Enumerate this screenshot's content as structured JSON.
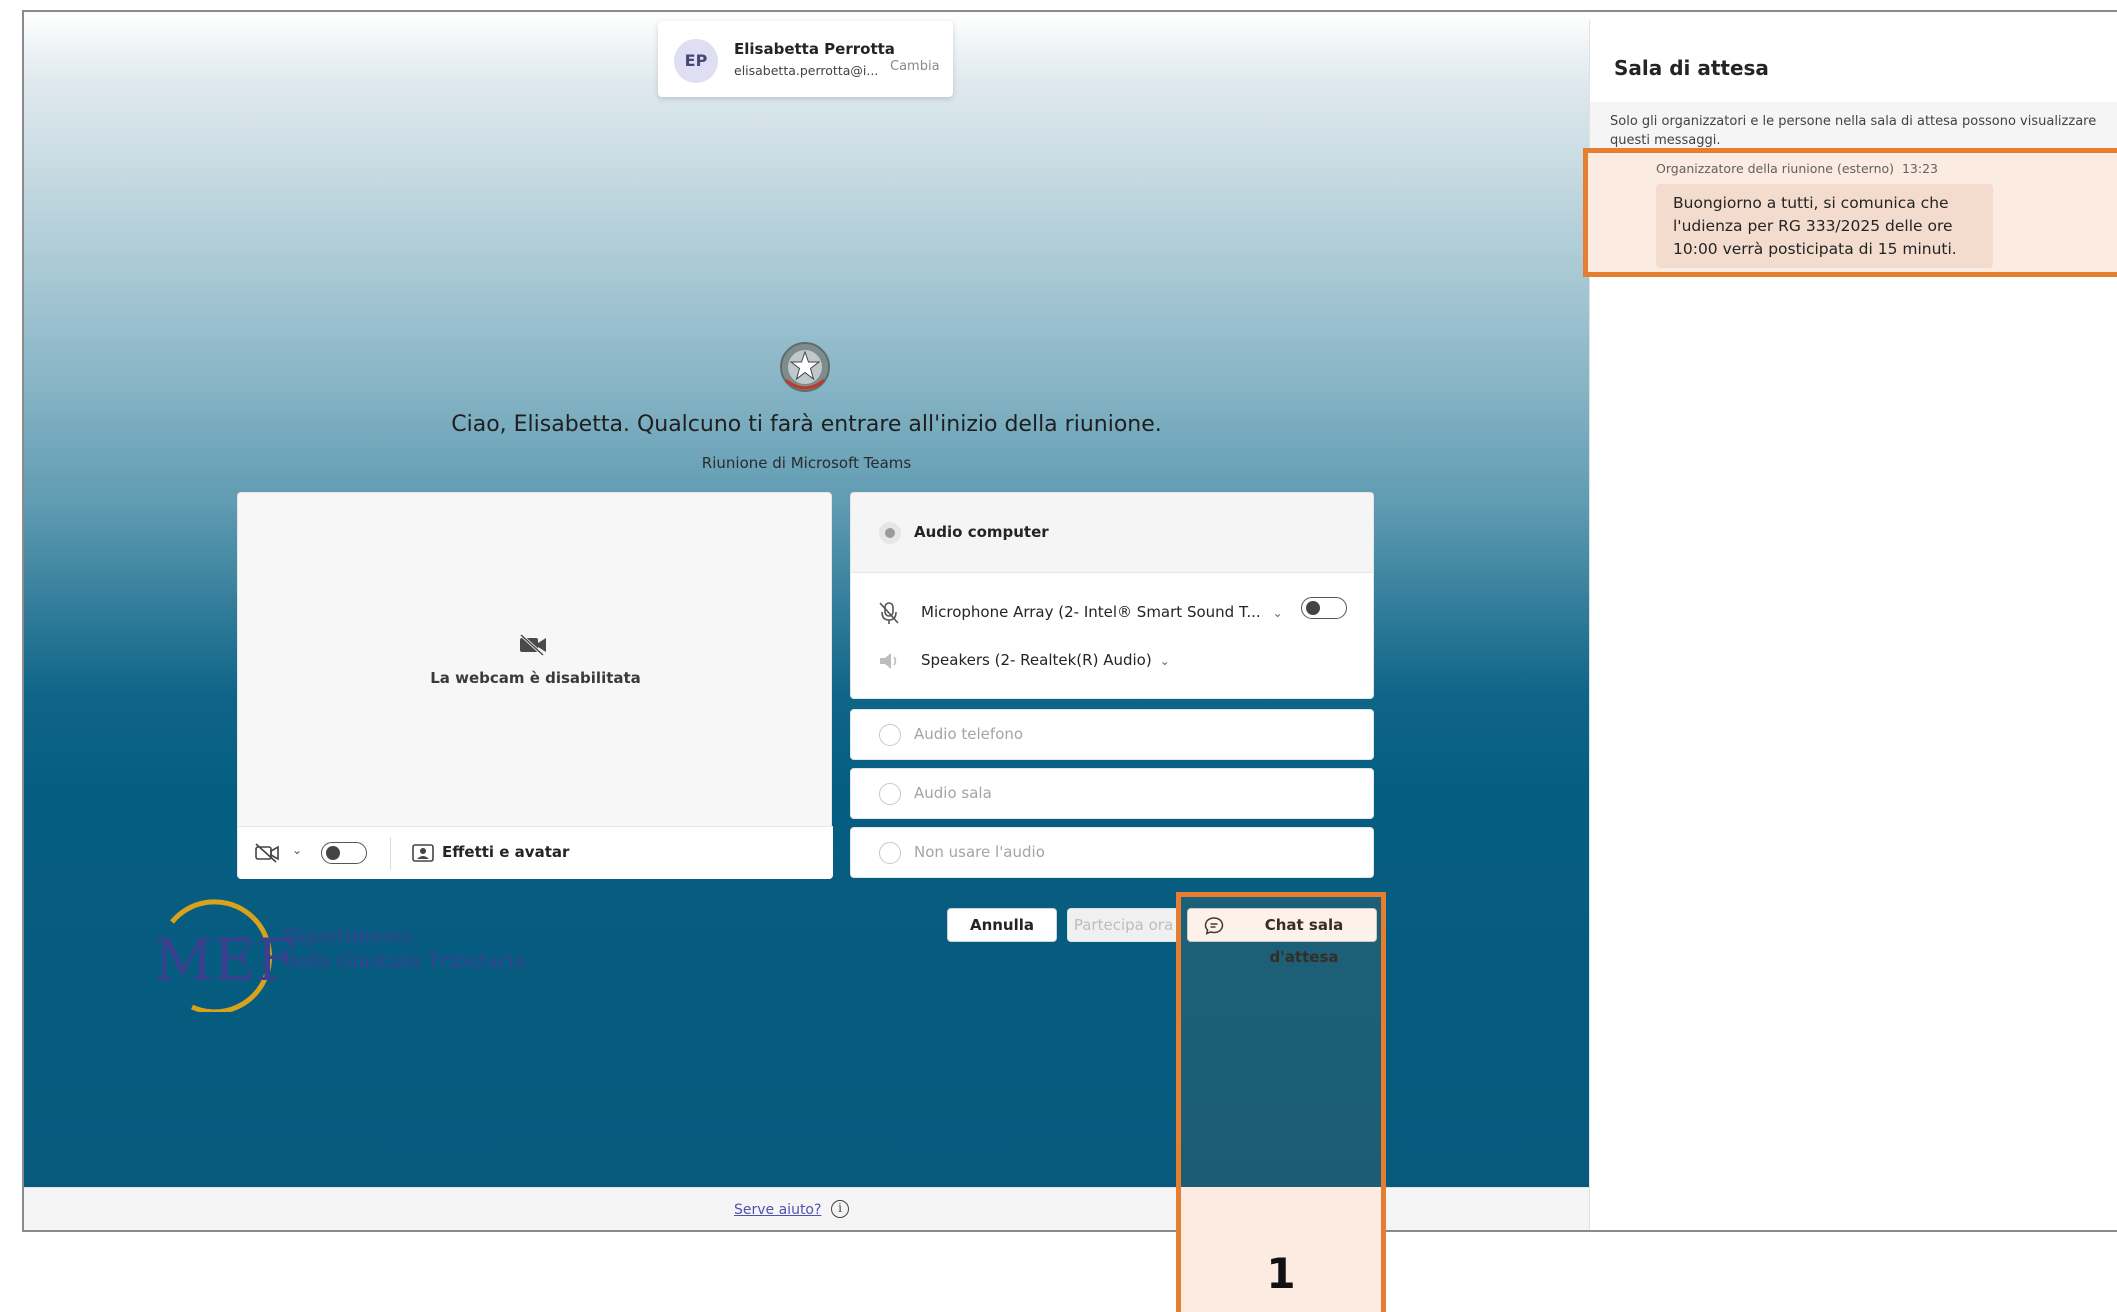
{
  "account": {
    "initials": "EP",
    "name": "Elisabetta Perrotta",
    "email": "elisabetta.perrotta@i...",
    "change_label": "Cambia"
  },
  "prejoin": {
    "greeting": "Ciao, Elisabetta. Qualcuno ti farà entrare all'inizio della riunione.",
    "subtitle": "Riunione di Microsoft Teams",
    "webcam_disabled": "La webcam è disabilitata",
    "effects_label": "Effetti e avatar"
  },
  "audio": {
    "computer": "Audio computer",
    "microphone": "Microphone Array (2- Intel® Smart Sound T...",
    "speakers": "Speakers (2- Realtek(R) Audio)",
    "phone": "Audio telefono",
    "room": "Audio sala",
    "none": "Non usare l'audio"
  },
  "buttons": {
    "cancel": "Annulla",
    "join": "Partecipa ora",
    "lobby_chat": "Chat sala d'attesa"
  },
  "footer": {
    "help": "Serve aiuto?"
  },
  "branding": {
    "logo_text": "MEF",
    "dept_line1": "Dipartimento",
    "dept_line2": "della Giustizia Tributaria"
  },
  "lobby_panel": {
    "title": "Sala di attesa",
    "note": "Solo gli organizzatori e le persone nella sala di attesa possono visualizzare questi messaggi.",
    "message": {
      "sender": "Organizzatore della riunione (esterno)",
      "time": "13:23",
      "text": "Buongiorno a tutti, si comunica che l'udienza per RG 333/2025 delle ore 10:00 verrà posticipata di 15 minuti."
    }
  },
  "annotation": {
    "label": "1"
  },
  "colors": {
    "highlight": "#e57e30",
    "accent": "#4f52b2"
  }
}
